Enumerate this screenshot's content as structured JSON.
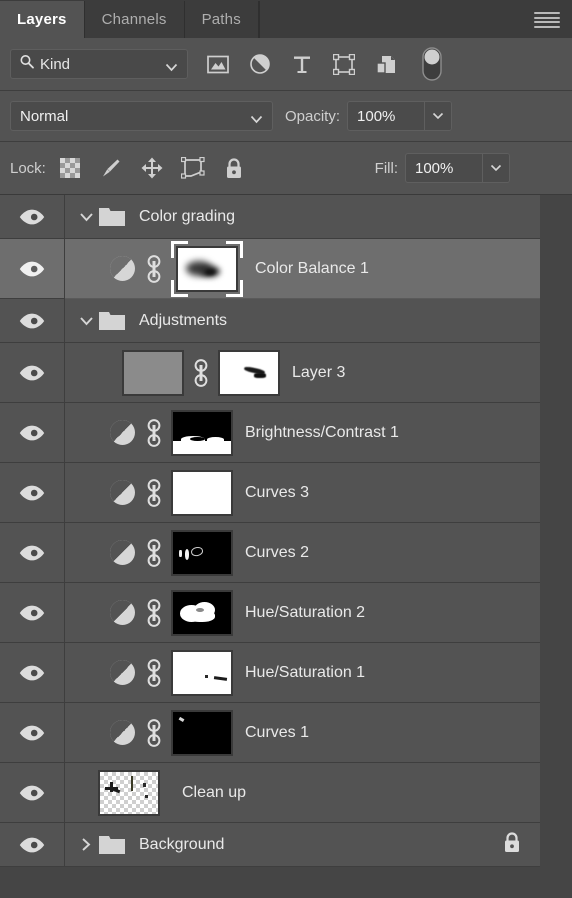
{
  "panel": {
    "title": "Layers",
    "tabs": [
      {
        "label": "Layers",
        "active": true
      },
      {
        "label": "Channels",
        "active": false
      },
      {
        "label": "Paths",
        "active": false
      }
    ],
    "menu_icon": "hamburger-menu-icon"
  },
  "filter_bar": {
    "search_icon": "magnifier-icon",
    "kind_label": "Kind",
    "chevron_icon": "chevron-down-icon",
    "type_filters": [
      {
        "name": "pixel-layer-filter-icon",
        "title": "Filter for pixel layers"
      },
      {
        "name": "adjustment-layer-filter-icon",
        "title": "Filter for adjustment layers"
      },
      {
        "name": "type-layer-filter-icon",
        "title": "Filter for type layers"
      },
      {
        "name": "shape-layer-filter-icon",
        "title": "Filter for shape layers"
      },
      {
        "name": "smart-object-filter-icon",
        "title": "Filter for smart objects"
      }
    ],
    "toggle_icon": "filter-toggle-switch"
  },
  "blend_bar": {
    "blend_mode": "Normal",
    "blend_chevron": "chevron-down-icon",
    "opacity_label": "Opacity:",
    "opacity_value": "100%",
    "opacity_chevron": "chevron-down-icon"
  },
  "lock_bar": {
    "lock_label": "Lock:",
    "lock_icons": [
      {
        "name": "lock-transparent-pixels-icon"
      },
      {
        "name": "lock-image-pixels-icon"
      },
      {
        "name": "lock-position-icon"
      },
      {
        "name": "lock-artboard-nesting-icon"
      },
      {
        "name": "lock-all-icon"
      }
    ],
    "fill_label": "Fill:",
    "fill_value": "100%",
    "fill_chevron": "chevron-down-icon"
  },
  "layers": [
    {
      "name": "Color grading",
      "type": "group",
      "expanded": true,
      "visible": true,
      "selected": false,
      "indent": 0,
      "locked": false
    },
    {
      "name": "Color Balance 1",
      "type": "adjustment",
      "visible": true,
      "selected": true,
      "indent": 1,
      "linked": true,
      "mask": "blurred-dark-blob-on-white",
      "mask_active": true,
      "locked": false
    },
    {
      "name": "Adjustments",
      "type": "group",
      "expanded": true,
      "visible": true,
      "selected": false,
      "indent": 0,
      "locked": false
    },
    {
      "name": "Layer 3",
      "type": "pixel",
      "visible": true,
      "selected": false,
      "indent": 1,
      "linked": true,
      "thumbnail": "flat-gray-noise",
      "mask": "white-with-dark-streak",
      "mask_active": false,
      "locked": false
    },
    {
      "name": "Brightness/Contrast 1",
      "type": "adjustment",
      "visible": true,
      "selected": false,
      "indent": 1,
      "linked": true,
      "mask": "black-top-white-bottom",
      "mask_active": false,
      "locked": false
    },
    {
      "name": "Curves 3",
      "type": "adjustment",
      "visible": true,
      "selected": false,
      "indent": 1,
      "linked": true,
      "mask": "all-white",
      "mask_active": false,
      "locked": false
    },
    {
      "name": "Curves 2",
      "type": "adjustment",
      "visible": true,
      "selected": false,
      "indent": 1,
      "linked": true,
      "mask": "black-with-small-white-marks",
      "mask_active": false,
      "locked": false
    },
    {
      "name": "Hue/Saturation 2",
      "type": "adjustment",
      "visible": true,
      "selected": false,
      "indent": 1,
      "linked": true,
      "mask": "black-with-white-cloud-blob",
      "mask_active": false,
      "locked": false
    },
    {
      "name": "Hue/Saturation 1",
      "type": "adjustment",
      "visible": true,
      "selected": false,
      "indent": 1,
      "linked": true,
      "mask": "white-with-small-dark-marks",
      "mask_active": false,
      "locked": false
    },
    {
      "name": "Curves 1",
      "type": "adjustment",
      "visible": true,
      "selected": false,
      "indent": 1,
      "linked": true,
      "mask": "black-with-tiny-white-mark",
      "mask_active": false,
      "locked": false
    },
    {
      "name": "Clean up",
      "type": "pixel",
      "visible": true,
      "selected": false,
      "indent": 0,
      "linked": false,
      "thumbnail": "transparent-checkerboard-with-marks",
      "locked": false
    },
    {
      "name": "Background",
      "type": "group",
      "expanded": false,
      "visible": true,
      "selected": false,
      "indent": 0,
      "locked": true,
      "lock_icon": "padlock-icon"
    }
  ],
  "icons": {
    "eye": "eye-visibility-icon",
    "chain": "layer-mask-link-icon",
    "folder": "folder-icon",
    "chevron_down": "chevron-down-icon",
    "chevron_right": "chevron-right-icon"
  },
  "colors": {
    "panel_bg": "#454545",
    "row_bg": "#535353",
    "row_selected_bg": "#6e6e6e",
    "tab_inactive_bg": "#3c3c3c",
    "text": "#e9e9e9",
    "muted_text": "#aeaeae"
  }
}
